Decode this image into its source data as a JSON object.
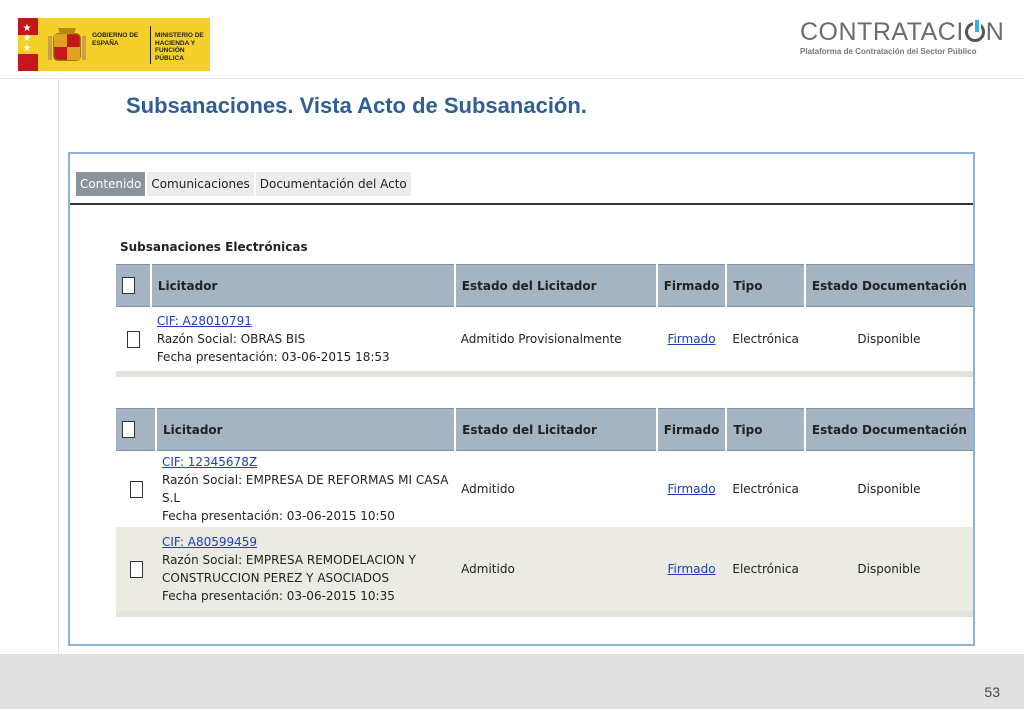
{
  "header": {
    "gov_line1": "GOBIERNO DE ESPAÑA",
    "gov_line2": "MINISTERIO DE HACIENDA Y FUNCIÓN PÚBLICA",
    "brand_title_a": "CONTRATACI",
    "brand_title_b": "N",
    "brand_subtitle": "Plataforma de Contratación del Sector Público"
  },
  "slide_title": "Subsanaciones. Vista Acto de Subsanación.",
  "tabs": [
    {
      "label": "Contenido",
      "active": true
    },
    {
      "label": "Comunicaciones",
      "active": false
    },
    {
      "label": "Documentación del Acto",
      "active": false
    }
  ],
  "section_title": "Subsanaciones Electrónicas",
  "columns": [
    "Licitador",
    "Estado del Licitador",
    "Firmado",
    "Tipo",
    "Estado Documentación"
  ],
  "table1": [
    {
      "cif": "CIF: A28010791",
      "razon": "Razón Social: OBRAS BIS",
      "razon2": "",
      "fecha": "Fecha presentación: 03-06-2015 18:53",
      "estado": "Admitido Provisionalmente",
      "firmado": "Firmado",
      "tipo": "Electrónica",
      "doc": "Disponible"
    }
  ],
  "table2": [
    {
      "cif": "CIF: 12345678Z",
      "razon": "Razón Social: EMPRESA DE REFORMAS MI CASA S.L",
      "razon2": "",
      "fecha": "Fecha presentación: 03-06-2015 10:50",
      "estado": "Admitido",
      "firmado": "Firmado",
      "tipo": "Electrónica",
      "doc": "Disponible"
    },
    {
      "cif": "CIF: A80599459",
      "razon": "Razón Social: EMPRESA REMODELACION Y",
      "razon2": "CONSTRUCCION PEREZ Y ASOCIADOS",
      "fecha": "Fecha presentación: 03-06-2015 10:35",
      "estado": "Admitido",
      "firmado": "Firmado",
      "tipo": "Electrónica",
      "doc": "Disponible"
    }
  ],
  "page_number": "53",
  "colors": {
    "title": "#2f5f95",
    "header_bg": "#a4b4c2",
    "link": "#1a3fbf",
    "frame_border": "#8cb2dc"
  }
}
